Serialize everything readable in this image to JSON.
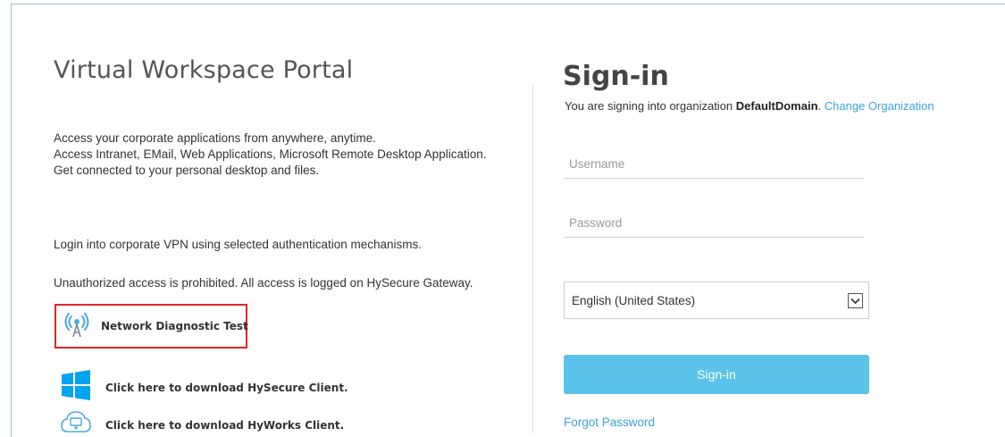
{
  "left": {
    "portal_title": "Virtual Workspace Portal",
    "desc_lines": [
      "Access your corporate applications from anywhere, anytime.",
      "Access Intranet, EMail, Web Applications, Microsoft Remote Desktop Application.",
      "Get connected to your personal desktop and files."
    ],
    "vpn_text": "Login into corporate VPN using selected authentication mechanisms.",
    "unauthorized_text": "Unauthorized access is prohibited. All access is logged on HySecure Gateway.",
    "network_diagnostic": "Network Diagnostic Test",
    "download_hysecure": "Click here to download HySecure Client.",
    "download_hyworks": "Click here to download HyWorks Client."
  },
  "signin": {
    "title": "Sign-in",
    "org_prefix": "You are signing into organization",
    "org_name": "DefaultDomain",
    "org_suffix": ".",
    "change_org": "Change Organization",
    "username_placeholder": "Username",
    "password_placeholder": "Password",
    "language_selected": "English (United States)",
    "button_label": "Sign-in",
    "forgot_password": "Forgot Password"
  },
  "colors": {
    "accent": "#5bc3e9",
    "link": "#3aa4d8",
    "highlight_border": "#e0262b",
    "windows_blue": "#00a4ef"
  }
}
